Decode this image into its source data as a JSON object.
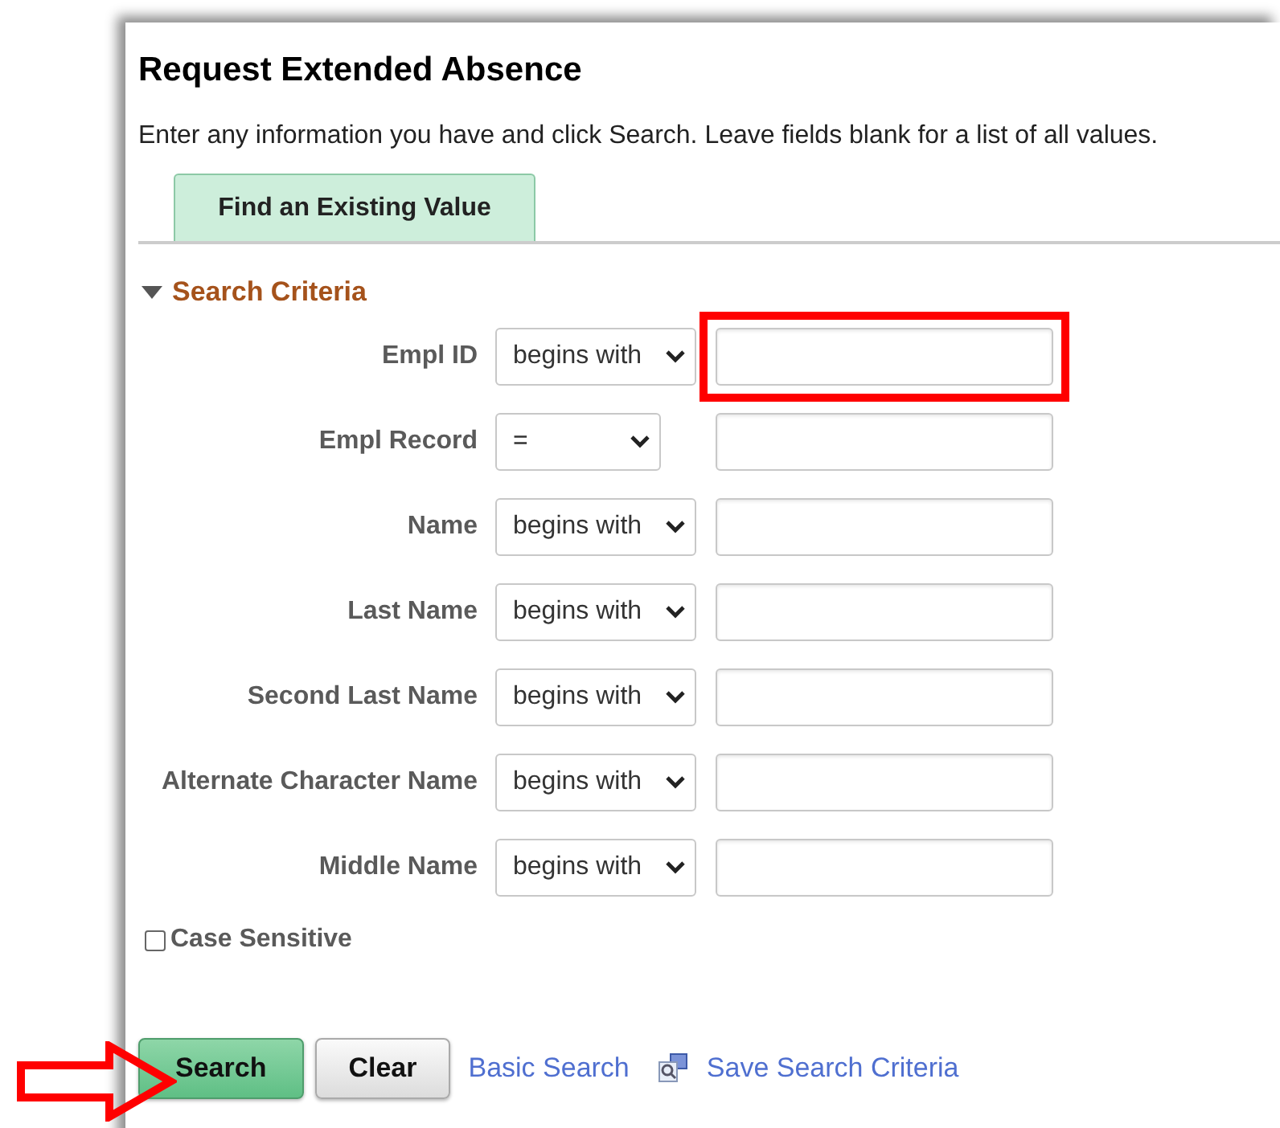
{
  "page": {
    "title": "Request Extended Absence",
    "instructions": "Enter any information you have and click Search. Leave fields blank for a list of all values."
  },
  "tabs": [
    {
      "label": "Find an Existing Value",
      "selected": true
    }
  ],
  "section": {
    "title": "Search Criteria",
    "expanded": true
  },
  "rows": [
    {
      "label": "Empl ID",
      "operator": "begins with",
      "highlighted": true
    },
    {
      "label": "Empl Record",
      "operator": "=",
      "highlighted": false
    },
    {
      "label": "Name",
      "operator": "begins with",
      "highlighted": false
    },
    {
      "label": "Last Name",
      "operator": "begins with",
      "highlighted": false
    },
    {
      "label": "Second Last Name",
      "operator": "begins with",
      "highlighted": false
    },
    {
      "label": "Alternate Character Name",
      "operator": "begins with",
      "highlighted": false
    },
    {
      "label": "Middle Name",
      "operator": "begins with",
      "highlighted": false
    }
  ],
  "case_sensitive": {
    "label": "Case Sensitive",
    "checked": false
  },
  "buttons": [
    {
      "label": "Search",
      "kind": "primary",
      "pointed_at": true
    },
    {
      "label": "Clear",
      "kind": "secondary",
      "pointed_at": false
    }
  ],
  "links": [
    {
      "label": "Basic Search",
      "icon": false
    },
    {
      "label": "Save Search Criteria",
      "icon": true
    }
  ]
}
